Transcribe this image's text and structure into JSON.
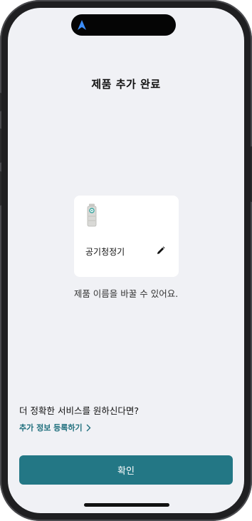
{
  "header": {
    "title": "제품 추가 완료"
  },
  "device": {
    "name": "공기청정기",
    "icon": "air-purifier-icon"
  },
  "hint": "제품 이름을 바꿀 수 있어요.",
  "promo": {
    "question": "더 정확한 서비스를 원하신다면?",
    "link_label": "추가 정보 등록하기"
  },
  "actions": {
    "confirm_label": "확인"
  },
  "colors": {
    "accent": "#237785",
    "background": "#f0f1f5",
    "link": "#1f6f7d"
  }
}
